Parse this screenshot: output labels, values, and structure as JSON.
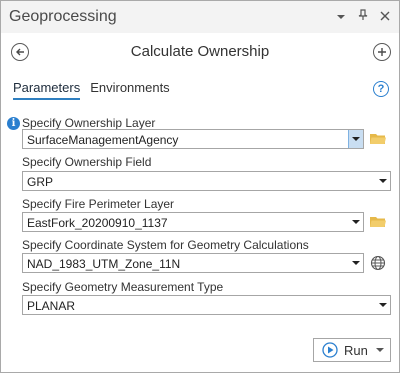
{
  "window": {
    "title": "Geoprocessing"
  },
  "titlebar_icons": [
    "chevron-down-icon",
    "pin-icon",
    "close-icon"
  ],
  "tool": {
    "title": "Calculate Ownership"
  },
  "tabs": [
    {
      "label": "Parameters",
      "active": true
    },
    {
      "label": "Environments",
      "active": false
    }
  ],
  "params": [
    {
      "label": "Specify Ownership Layer",
      "value": "SurfaceManagementAgency",
      "icon": "folder-icon"
    },
    {
      "label": "Specify Ownership Field",
      "value": "GRP"
    },
    {
      "label": "Specify Fire Perimeter Layer",
      "value": "EastFork_20200910_1137",
      "icon": "folder-icon"
    },
    {
      "label": "Specify Coordinate System for Geometry Calculations",
      "value": "NAD_1983_UTM_Zone_11N",
      "icon": "globe-icon"
    },
    {
      "label": "Specify Geometry Measurement Type",
      "value": "PLANAR"
    }
  ],
  "run": {
    "label": "Run"
  },
  "colors": {
    "accent": "#2a7fcf",
    "folder": "#e6b94a"
  }
}
